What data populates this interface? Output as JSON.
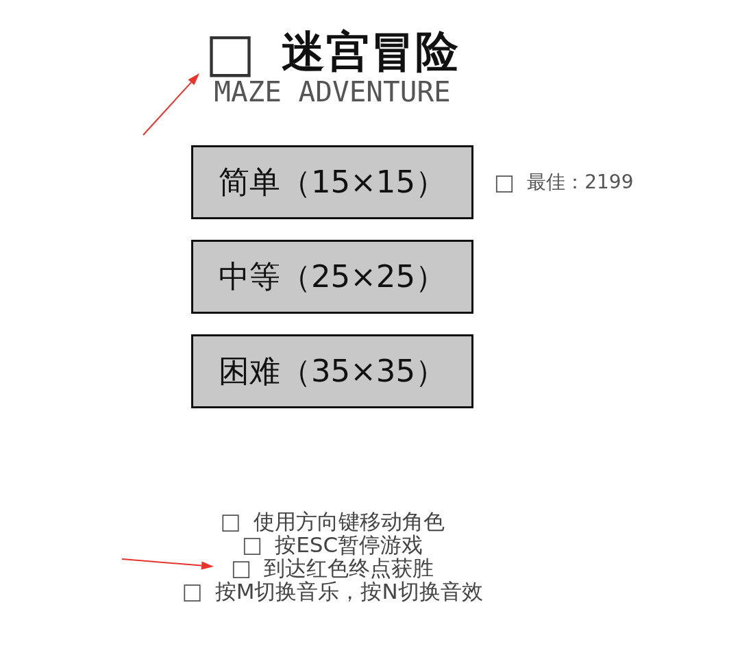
{
  "title": {
    "glyph": "□",
    "text": "迷宫冒险"
  },
  "subtitle": "MAZE ADVENTURE",
  "difficulties": [
    {
      "label": "简单（15×15）",
      "best": {
        "glyph": "□",
        "text": "最佳：2199"
      }
    },
    {
      "label": "中等（25×25）"
    },
    {
      "label": "困难（35×35）"
    }
  ],
  "instructions": [
    {
      "glyph": "□",
      "text": "使用方向键移动角色"
    },
    {
      "glyph": "□",
      "text": "按ESC暂停游戏"
    },
    {
      "glyph": "□",
      "text": "到达红色终点获胜"
    },
    {
      "glyph": "□",
      "text": "按M切换音乐，按N切换音效"
    }
  ],
  "annotations": [
    {
      "kind": "arrow"
    },
    {
      "kind": "arrow"
    }
  ]
}
